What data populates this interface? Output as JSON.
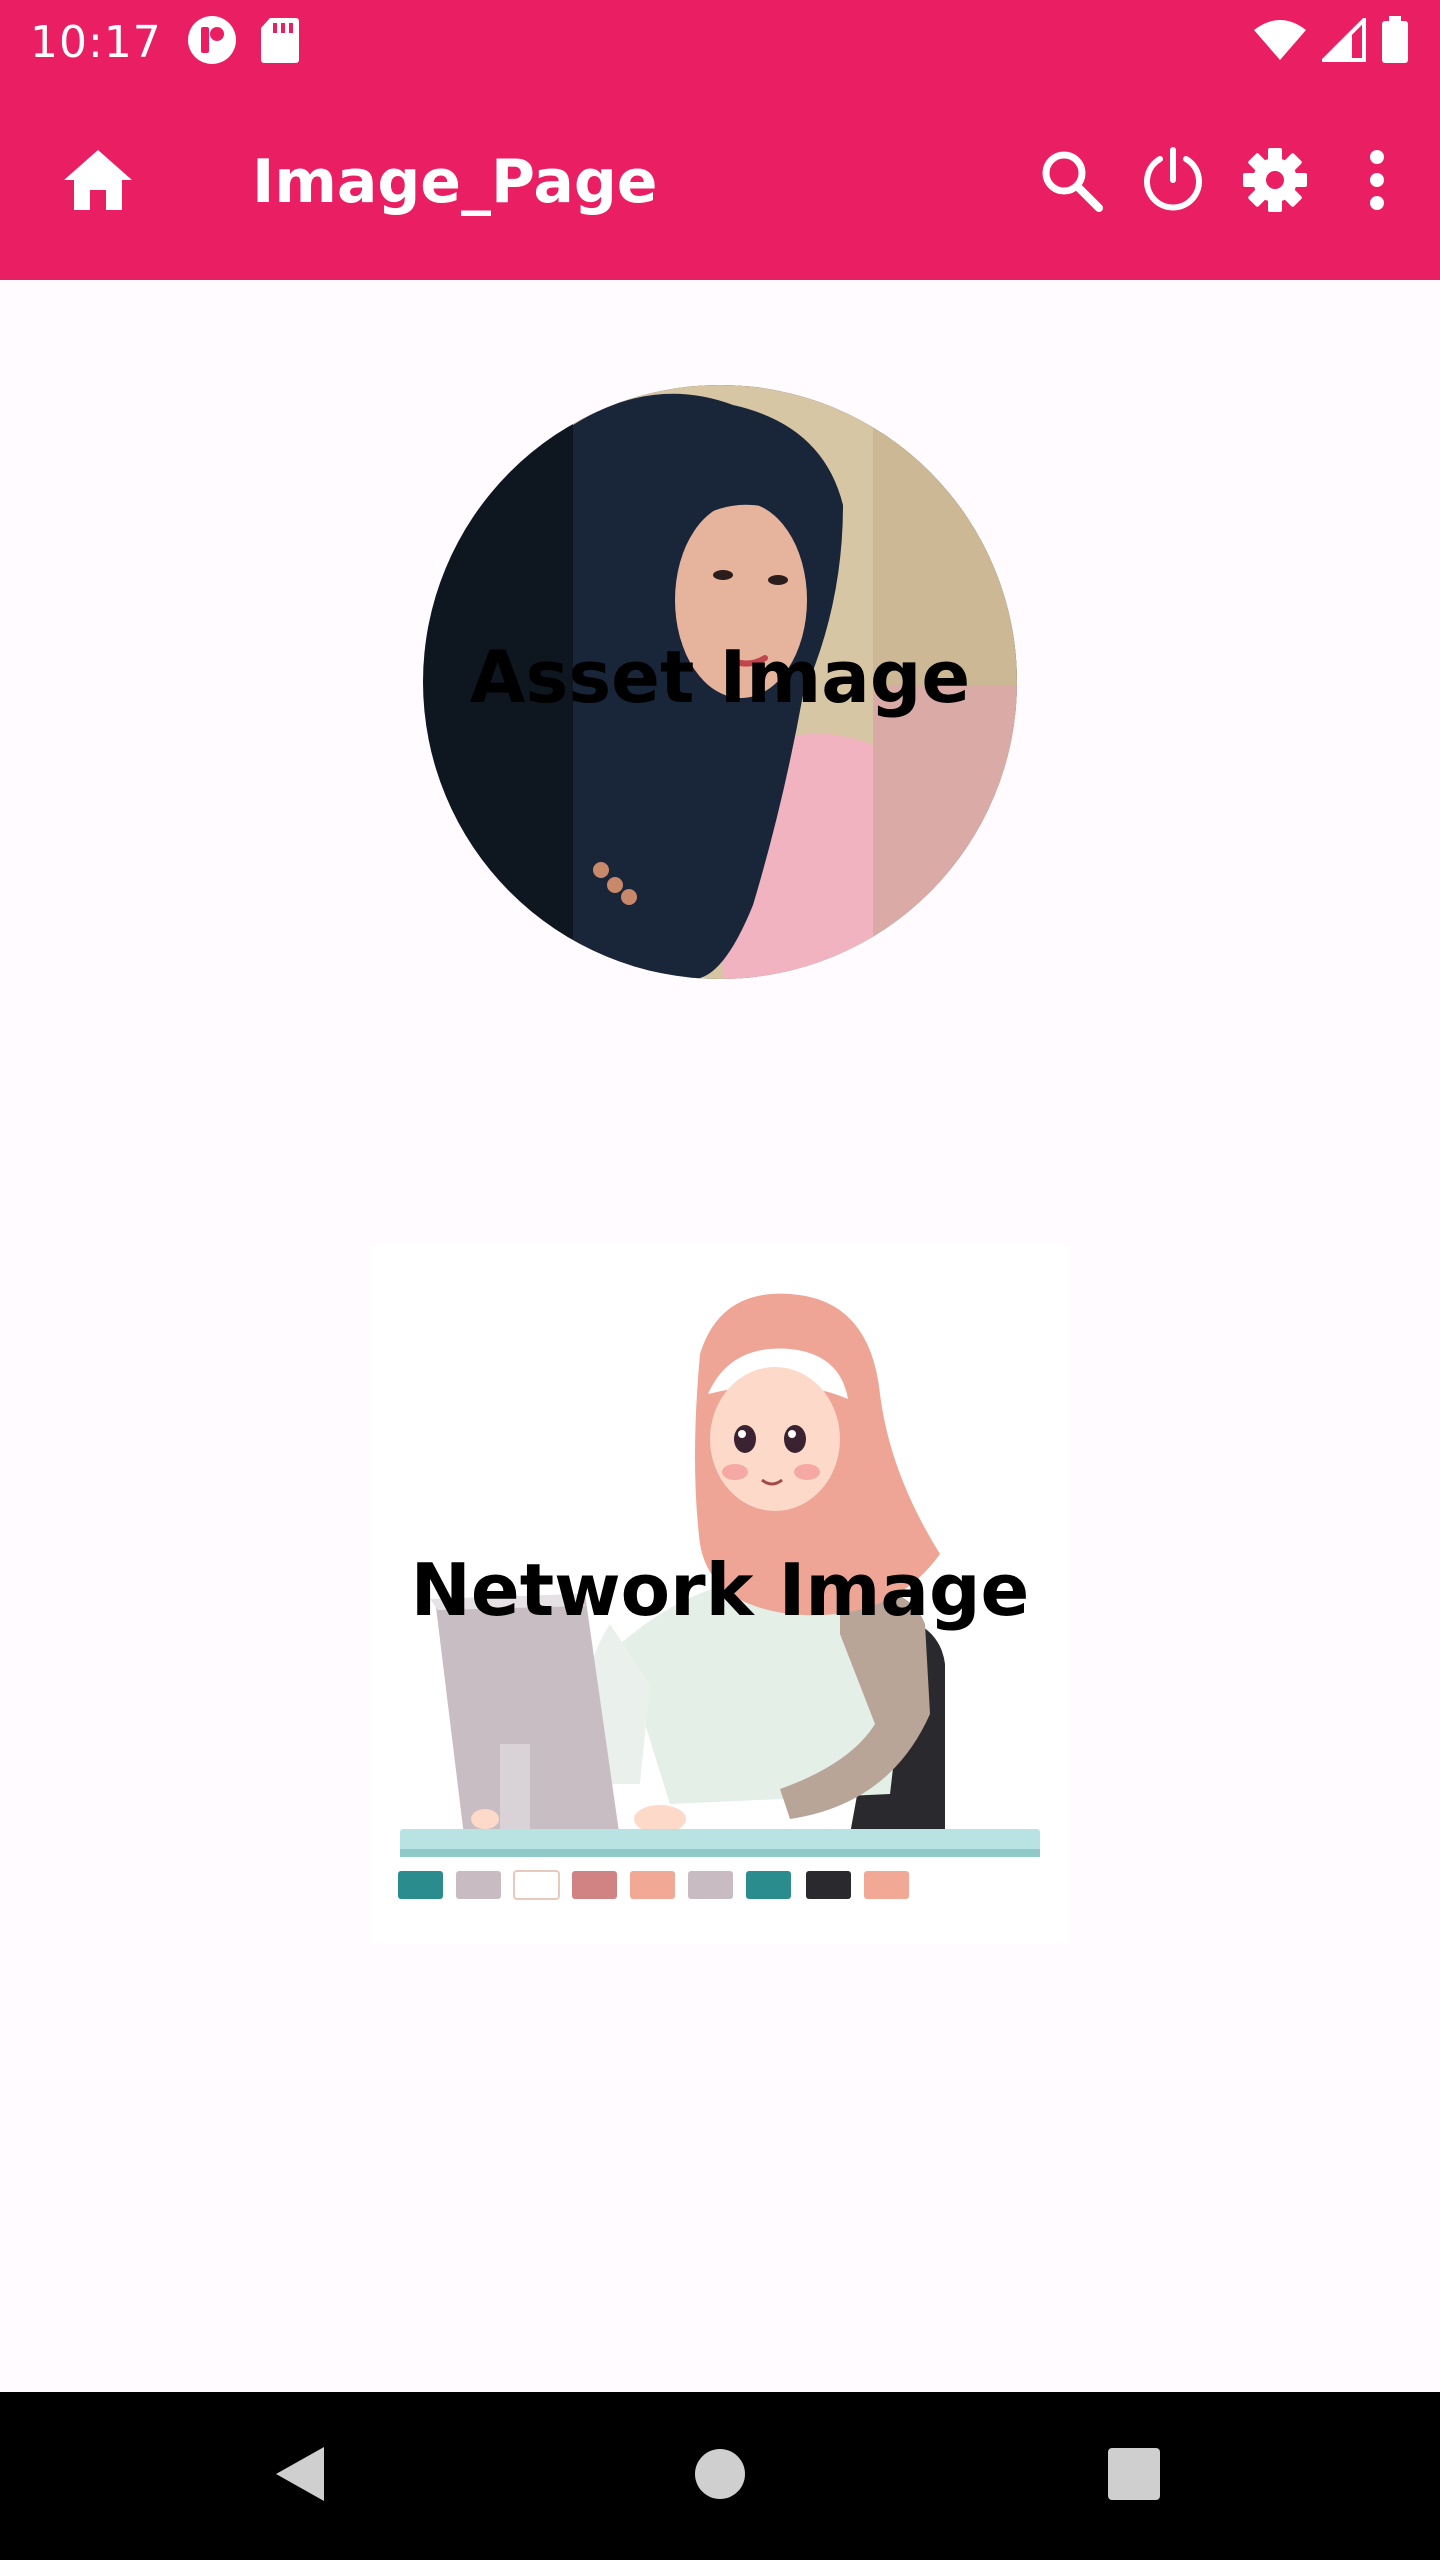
{
  "status_bar": {
    "time": "10:17",
    "icons": [
      "notification-app-icon",
      "sd-card-icon",
      "wifi-icon",
      "cell-signal-icon",
      "battery-icon"
    ]
  },
  "app_bar": {
    "title": "Image_Page",
    "leading_icon": "home-icon",
    "action_icons": [
      "search-icon",
      "power-icon",
      "settings-icon",
      "overflow-menu-icon"
    ],
    "color": "#e91e63"
  },
  "content": {
    "asset_image_caption": "Asset Image",
    "network_image_caption": "Network Image",
    "background": "#fffbfe"
  },
  "nav_bar": {
    "icons": [
      "back-icon",
      "home-circle-icon",
      "recents-icon"
    ]
  }
}
